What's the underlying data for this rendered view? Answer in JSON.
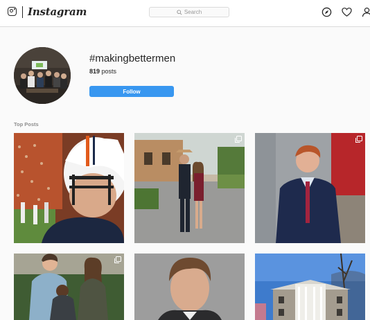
{
  "nav": {
    "wordmark": "Instagram",
    "search_placeholder": "Search",
    "icons": [
      "instagram-logo-icon",
      "compass-icon",
      "heart-icon",
      "person-icon"
    ]
  },
  "header": {
    "hashtag": "#makingbettermen",
    "post_count": "819",
    "post_label": " posts",
    "follow_label": "Follow",
    "follow_color": "#3897f0"
  },
  "section": {
    "top_posts_label": "Top Posts"
  },
  "posts": [
    {
      "description": "football player in helmet",
      "multiple": false
    },
    {
      "description": "couple outside building",
      "multiple": true
    },
    {
      "description": "young man in blue suit",
      "multiple": true
    },
    {
      "description": "family portrait",
      "multiple": true
    },
    {
      "description": "headshot of man",
      "multiple": false
    },
    {
      "description": "white house with columns",
      "multiple": false
    }
  ]
}
